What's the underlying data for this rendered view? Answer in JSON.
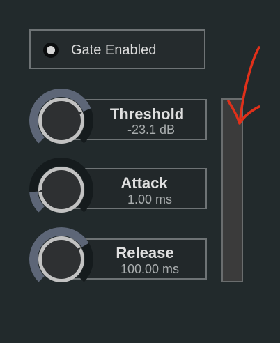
{
  "gate": {
    "label": "Gate Enabled",
    "enabled": true
  },
  "controls": [
    {
      "name": "Threshold",
      "value": "-23.1 dB",
      "level": 0.75
    },
    {
      "name": "Attack",
      "value": "1.00 ms",
      "level": 0.15
    },
    {
      "name": "Release",
      "value": "100.00 ms",
      "level": 0.72
    }
  ],
  "colors": {
    "background": "#222a2c",
    "knob_arc_active": "#5d6677",
    "knob_track": "#151b1d",
    "knob_ring": "#c2c2c2",
    "knob_body": "#2e3032",
    "annotation": "#e0301a"
  },
  "annotation": {
    "shape": "arrow",
    "color": "#e0301a"
  }
}
